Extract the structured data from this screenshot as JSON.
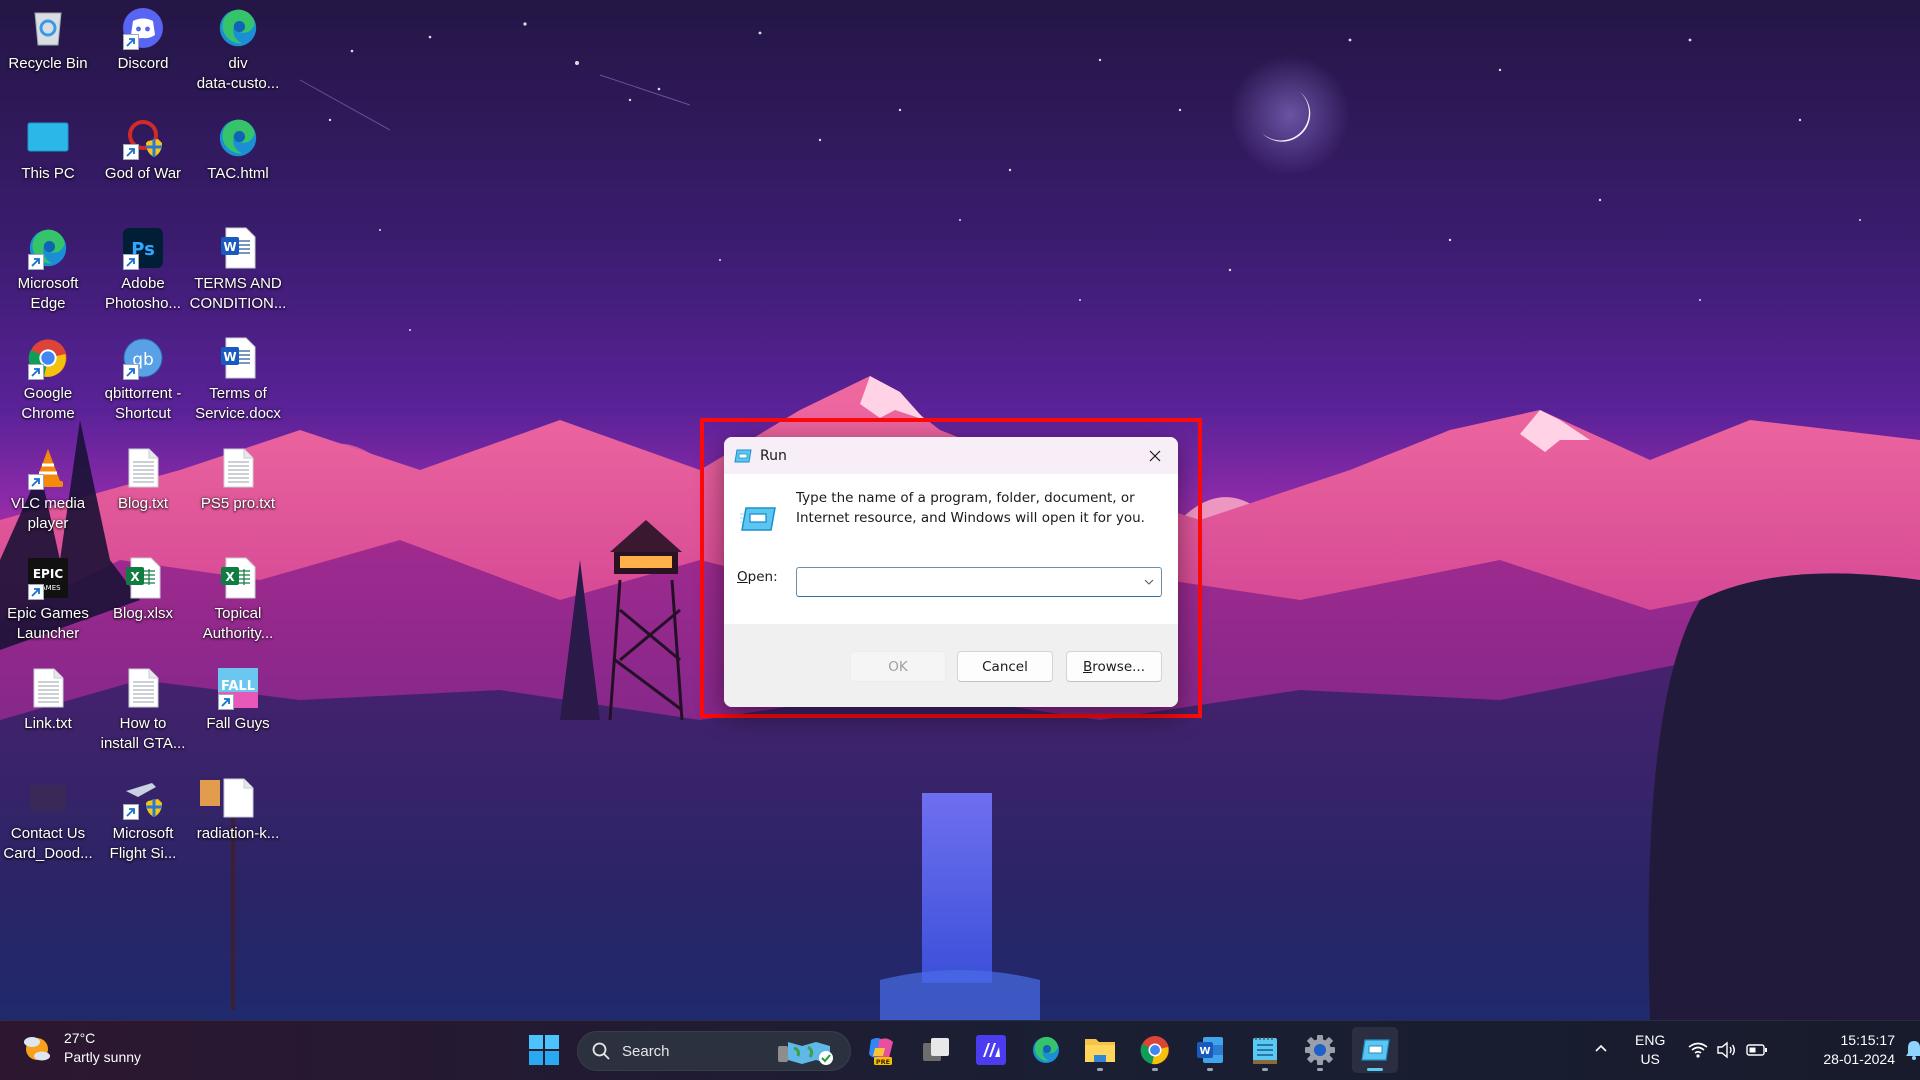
{
  "desktop": {
    "icons": [
      {
        "label": "Recycle Bin",
        "icon": "recycle-bin-icon",
        "shortcut": false
      },
      {
        "label": "Discord",
        "icon": "discord-icon",
        "shortcut": true
      },
      {
        "label": "div\ndata-custo...",
        "icon": "edge-html-file-icon",
        "shortcut": false
      },
      {
        "label": "This PC",
        "icon": "this-pc-icon",
        "shortcut": false
      },
      {
        "label": "God of War",
        "icon": "god-of-war-icon",
        "shortcut": true
      },
      {
        "label": "TAC.html",
        "icon": "edge-html-file-icon",
        "shortcut": false
      },
      {
        "label": "Microsoft\nEdge",
        "icon": "edge-icon",
        "shortcut": true
      },
      {
        "label": "Adobe\nPhotosho...",
        "icon": "photoshop-icon",
        "shortcut": true
      },
      {
        "label": "TERMS AND\nCONDITION...",
        "icon": "word-doc-icon",
        "shortcut": false
      },
      {
        "label": "Google\nChrome",
        "icon": "chrome-icon",
        "shortcut": true
      },
      {
        "label": "qbittorrent -\nShortcut",
        "icon": "qbittorrent-icon",
        "shortcut": true
      },
      {
        "label": "Terms of\nService.docx",
        "icon": "word-doc-icon",
        "shortcut": false
      },
      {
        "label": "VLC media\nplayer",
        "icon": "vlc-icon",
        "shortcut": true
      },
      {
        "label": "Blog.txt",
        "icon": "text-file-icon",
        "shortcut": false
      },
      {
        "label": "PS5 pro.txt",
        "icon": "text-file-icon",
        "shortcut": false
      },
      {
        "label": "Epic Games\nLauncher",
        "icon": "epic-games-icon",
        "shortcut": true
      },
      {
        "label": "Blog.xlsx",
        "icon": "excel-file-icon",
        "shortcut": false
      },
      {
        "label": "Topical\nAuthority...",
        "icon": "excel-file-icon",
        "shortcut": false
      },
      {
        "label": "Link.txt",
        "icon": "text-file-icon",
        "shortcut": false
      },
      {
        "label": "How to\ninstall GTA...",
        "icon": "text-file-icon",
        "shortcut": false
      },
      {
        "label": "Fall Guys",
        "icon": "fall-guys-icon",
        "shortcut": true
      },
      {
        "label": "Contact Us\nCard_Dood...",
        "icon": "image-file-icon",
        "shortcut": false
      },
      {
        "label": "Microsoft\nFlight Si...",
        "icon": "flight-simulator-icon",
        "shortcut": true
      },
      {
        "label": "radiation-k...",
        "icon": "blank-file-icon",
        "shortcut": false
      }
    ]
  },
  "run_dialog": {
    "title": "Run",
    "description": "Type the name of a program, folder, document, or Internet resource, and Windows will open it for you.",
    "open_label_accel": "O",
    "open_label_rest": "pen:",
    "open_value": "",
    "ok_label": "OK",
    "cancel_label": "Cancel",
    "browse_label_accel": "B",
    "browse_label_rest": "rowse...",
    "highlight_color": "#ff0a0a"
  },
  "taskbar": {
    "weather": {
      "temperature": "27°C",
      "condition": "Partly sunny"
    },
    "search_label": "Search",
    "pinned": [
      {
        "name": "start",
        "icon": "windows-start-icon"
      },
      {
        "name": "copilot",
        "icon": "copilot-icon",
        "badge": "PRE"
      },
      {
        "name": "task-view",
        "icon": "task-view-icon"
      },
      {
        "name": "motion-app",
        "icon": "motion-app-icon"
      },
      {
        "name": "edge",
        "icon": "edge-icon"
      },
      {
        "name": "file-explorer",
        "icon": "folder-icon"
      },
      {
        "name": "chrome",
        "icon": "chrome-icon"
      },
      {
        "name": "word",
        "icon": "word-icon"
      },
      {
        "name": "notepad",
        "icon": "notepad-icon"
      },
      {
        "name": "settings",
        "icon": "gear-icon"
      },
      {
        "name": "run",
        "icon": "run-icon"
      }
    ],
    "tray": {
      "lang_top": "ENG",
      "lang_bottom": "US",
      "time": "15:15:17",
      "date": "28-01-2024"
    }
  }
}
